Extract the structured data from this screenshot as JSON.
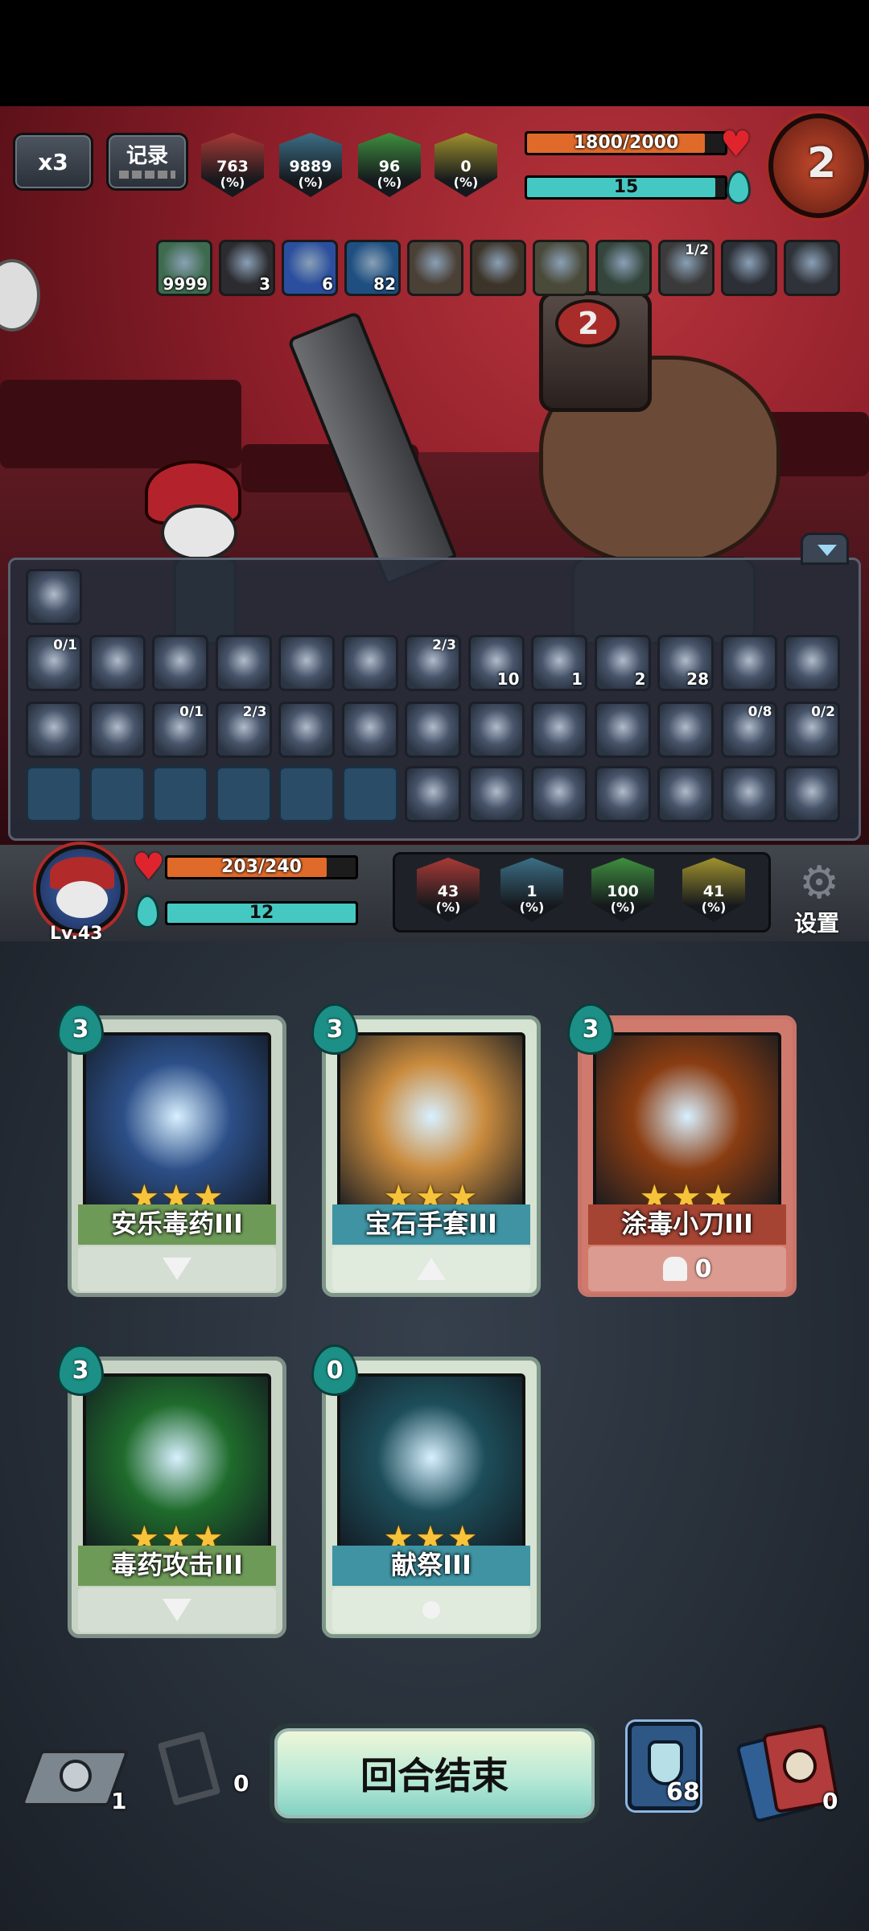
{
  "top": {
    "speed_label": "x3",
    "log_label": "记录",
    "enemy_stats": [
      {
        "value": "763",
        "unit": "(%)",
        "color": "#a83a36",
        "icon": "attack-icon"
      },
      {
        "value": "9889",
        "unit": "(%)",
        "color": "#3c6f86",
        "icon": "question-icon"
      },
      {
        "value": "96",
        "unit": "(%)",
        "color": "#3f8f3f",
        "icon": "defense-icon"
      },
      {
        "value": "0",
        "unit": "(%)",
        "color": "#a0922e",
        "icon": "crit-icon"
      }
    ],
    "enemy_hp": "1800/2000",
    "enemy_hp_ratio": 0.9,
    "enemy_energy": "15",
    "enemy_energy_ratio": 0.95
  },
  "enemy_buffs": [
    {
      "icon": "skull-poison-icon",
      "value": "9999",
      "tag": "",
      "color": "#3e6b4e"
    },
    {
      "icon": "lightning-icon",
      "value": "3",
      "tag": "",
      "color": "#2c2c30"
    },
    {
      "icon": "wind-icon",
      "value": "6",
      "tag": "",
      "color": "#2b4f9e"
    },
    {
      "icon": "shield-icon",
      "value": "82",
      "tag": "",
      "color": "#1e4f80"
    },
    {
      "icon": "book-icon",
      "value": "",
      "tag": "",
      "color": "#4a4036"
    },
    {
      "icon": "horn-icon",
      "value": "",
      "tag": "",
      "color": "#3d3429"
    },
    {
      "icon": "helmet-icon",
      "value": "",
      "tag": "",
      "color": "#4a4a3a"
    },
    {
      "icon": "green-gem-icon",
      "value": "",
      "tag": "",
      "color": "#34453c"
    },
    {
      "icon": "cage-icon",
      "value": "",
      "tag": "1/2",
      "color": "#3a3a3a"
    },
    {
      "icon": "spiked-armor-icon",
      "value": "",
      "tag": "",
      "color": "#2c2f36"
    },
    {
      "icon": "beast-icon",
      "value": "",
      "tag": "",
      "color": "#2f3238"
    }
  ],
  "relics": {
    "row0": [
      {
        "icon": "rune-stone-icon",
        "value": "",
        "tag": ""
      }
    ],
    "row1": [
      {
        "icon": "vortex-icon",
        "value": "",
        "tag": "0/1"
      },
      {
        "icon": "sword-icon",
        "value": "",
        "tag": ""
      },
      {
        "icon": "sun-orb-icon",
        "value": "",
        "tag": ""
      },
      {
        "icon": "leaf-icon",
        "value": "",
        "tag": ""
      },
      {
        "icon": "hand-icon",
        "value": "",
        "tag": ""
      },
      {
        "icon": "swirl-orb-icon",
        "value": "",
        "tag": ""
      },
      {
        "icon": "red-egg-icon",
        "value": "",
        "tag": "2/3"
      },
      {
        "icon": "poison-icon",
        "value": "10",
        "tag": ""
      },
      {
        "icon": "lightning-orb-icon",
        "value": "1",
        "tag": ""
      },
      {
        "icon": "shield-icon",
        "value": "2",
        "tag": ""
      },
      {
        "icon": "slash-icon",
        "value": "28",
        "tag": ""
      },
      {
        "icon": "crystal-icon",
        "value": "",
        "tag": ""
      },
      {
        "icon": "turtle-shell-icon",
        "value": "",
        "tag": ""
      }
    ],
    "row2": [
      {
        "icon": "golem-icon",
        "value": "",
        "tag": ""
      },
      {
        "icon": "pan-icon",
        "value": "",
        "tag": ""
      },
      {
        "icon": "pacifier-icon",
        "value": "",
        "tag": "0/1"
      },
      {
        "icon": "spellbook-icon",
        "value": "",
        "tag": "2/3"
      },
      {
        "icon": "doll-icon",
        "value": "",
        "tag": ""
      },
      {
        "icon": "snail-icon",
        "value": "",
        "tag": ""
      },
      {
        "icon": "cookie-icon",
        "value": "",
        "tag": ""
      },
      {
        "icon": "bell-icon",
        "value": "",
        "tag": ""
      },
      {
        "icon": "hood-icon",
        "value": "",
        "tag": ""
      },
      {
        "icon": "bracer-icon",
        "value": "",
        "tag": ""
      },
      {
        "icon": "pig-icon",
        "value": "",
        "tag": ""
      },
      {
        "icon": "dagger-icon",
        "value": "",
        "tag": "0/8"
      },
      {
        "icon": "armor-icon",
        "value": "",
        "tag": "0/2"
      }
    ],
    "row3": [
      {
        "icon": "locked-fist-icon",
        "value": "",
        "tag": "",
        "locked": true
      },
      {
        "icon": "locked-claw-icon",
        "value": "",
        "tag": "",
        "locked": true
      },
      {
        "icon": "locked-tree-icon",
        "value": "",
        "tag": "",
        "locked": true
      },
      {
        "icon": "locked-skull-icon",
        "value": "",
        "tag": "",
        "locked": true
      },
      {
        "icon": "locked-potion-icon",
        "value": "",
        "tag": "",
        "locked": true
      },
      {
        "icon": "locked-demon-icon",
        "value": "",
        "tag": "",
        "locked": true
      },
      {
        "icon": "chef-icon",
        "value": "",
        "tag": ""
      },
      {
        "icon": "knife-icon",
        "value": "",
        "tag": ""
      },
      {
        "icon": "water-drop-icon",
        "value": "",
        "tag": ""
      },
      {
        "icon": "round-shield-icon",
        "value": "",
        "tag": ""
      },
      {
        "icon": "bread-icon",
        "value": "",
        "tag": ""
      },
      {
        "icon": "crown-icon",
        "value": "",
        "tag": ""
      },
      {
        "icon": "mask-icon",
        "value": "",
        "tag": ""
      }
    ]
  },
  "player": {
    "level": "Lv.43",
    "hp": "203/240",
    "hp_ratio": 0.846,
    "energy": "12",
    "energy_ratio": 1.0,
    "stats": [
      {
        "value": "43",
        "unit": "(%)",
        "color": "#a83a36"
      },
      {
        "value": "1",
        "unit": "(%)",
        "color": "#3c6f86"
      },
      {
        "value": "100",
        "unit": "(%)",
        "color": "#3f8f3f"
      },
      {
        "value": "41",
        "unit": "(%)",
        "color": "#a0922e"
      }
    ],
    "settings_label": "设置"
  },
  "cards": [
    {
      "cost": "3",
      "title": "安乐毒药III",
      "stars": "★★★",
      "footer": "",
      "foot_icon": "down-arrow-icon",
      "art": "poison-flask-art",
      "frame": "#7d8f86",
      "bg": "#c7d3c4",
      "titlebg": "#6e9a58",
      "artcolor": "#2c4f88"
    },
    {
      "cost": "3",
      "title": "宝石手套III",
      "stars": "★★★",
      "footer": "",
      "foot_icon": "up-arrow-icon",
      "art": "gem-gauntlet-art",
      "frame": "#7f9789",
      "bg": "#d6e3d2",
      "titlebg": "#3f93a2",
      "artcolor": "#c98b3e"
    },
    {
      "cost": "3",
      "title": "涂毒小刀III",
      "stars": "★★★",
      "footer": "0",
      "foot_icon": "hand-icon",
      "art": "poison-dagger-art",
      "frame": "#c8746a",
      "bg": "#d07a6d",
      "titlebg": "#a54433",
      "artcolor": "#8a3d12"
    },
    {
      "cost": "3",
      "title": "毒药攻击III",
      "stars": "★★★",
      "footer": "",
      "foot_icon": "down-arrow-icon",
      "art": "poison-strike-art",
      "frame": "#7d8f86",
      "bg": "#c7d3c4",
      "titlebg": "#6e9a58",
      "artcolor": "#1f6b2c"
    },
    {
      "cost": "0",
      "title": "献祭III",
      "stars": "★★★",
      "footer": "",
      "foot_icon": "sparkle-icon",
      "art": "sacrifice-art",
      "frame": "#7f9789",
      "bg": "#d6e3d2",
      "titlebg": "#3f93a2",
      "artcolor": "#1d4e5a"
    }
  ],
  "bottom": {
    "draw_pile_count": "1",
    "grave_count": "0",
    "end_turn_label": "回合结束",
    "deck_count": "68",
    "discard_count": "0"
  }
}
